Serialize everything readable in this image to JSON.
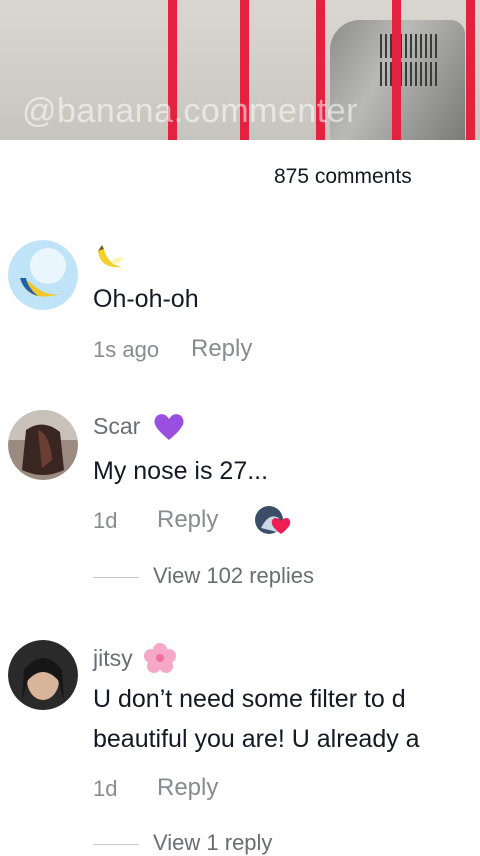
{
  "video": {
    "watermark": "@banana.commenter"
  },
  "comments_count": "875 comments",
  "comments": [
    {
      "username_icon": "banana-emoji",
      "text": "Oh-oh-oh",
      "time": "1s ago",
      "reply_label": "Reply"
    },
    {
      "username": "Scar",
      "username_icon": "purple-heart-emoji",
      "text": "My nose is 27...",
      "time": "1d",
      "reply_label": "Reply",
      "liked_by_creator_icon": "creator-like-avatar-icon",
      "view_replies": "View 102 replies"
    },
    {
      "username": "jitsy",
      "username_icon": "cherry-blossom-emoji",
      "text_line1": "U don’t need some filter to d",
      "text_line2": "beautiful you are! U already a",
      "time": "1d",
      "reply_label": "Reply",
      "view_replies": "View 1 reply"
    }
  ],
  "colors": {
    "accent_red": "#e3223f",
    "text": "#161823",
    "muted": "#8a8b91"
  }
}
